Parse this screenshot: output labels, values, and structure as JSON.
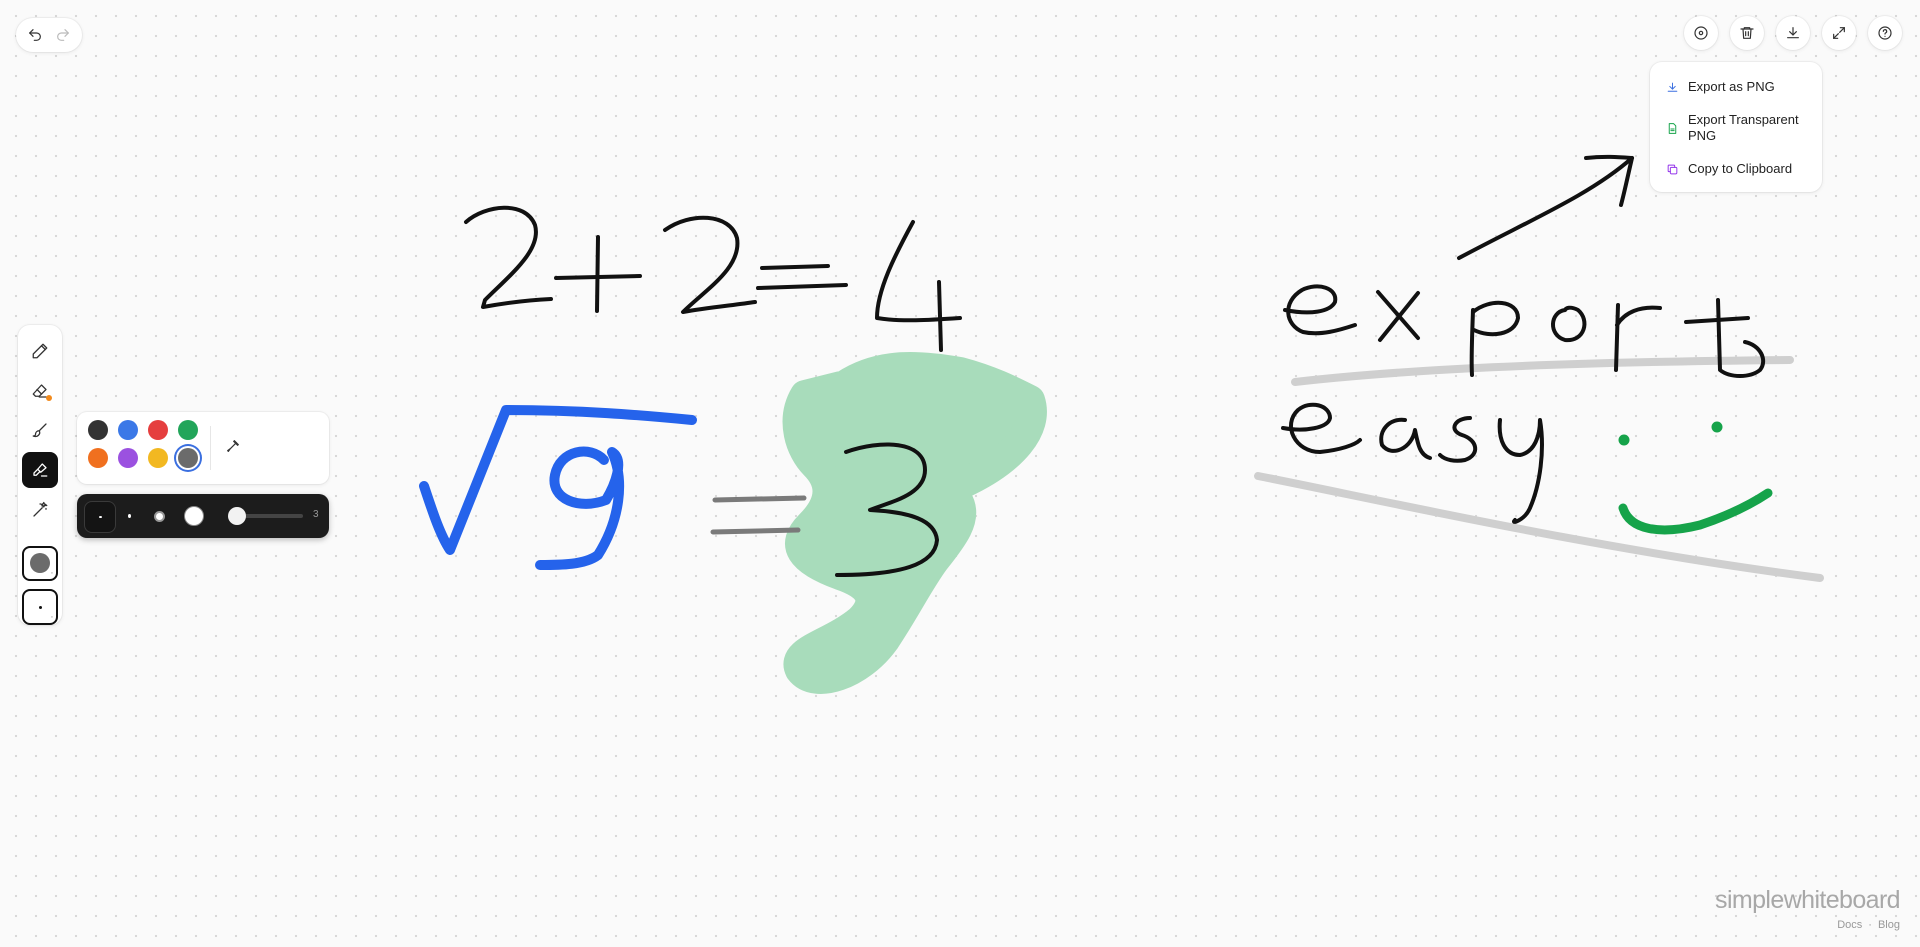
{
  "app": {
    "brand": "simplewhiteboard"
  },
  "footer": {
    "docs": "Docs",
    "separator": "·",
    "blog": "Blog"
  },
  "history": {
    "undo_icon": "undo-icon",
    "redo_icon": "redo-icon"
  },
  "top_toolbar": {
    "items": [
      {
        "name": "info-icon"
      },
      {
        "name": "trash-icon"
      },
      {
        "name": "download-icon"
      },
      {
        "name": "fullscreen-icon"
      },
      {
        "name": "help-icon"
      }
    ]
  },
  "export_menu": {
    "items": [
      {
        "label": "Export as PNG",
        "icon": "download-icon",
        "color": "#3a6fe0"
      },
      {
        "label": "Export Transparent PNG",
        "icon": "file-icon",
        "color": "#16a34a"
      },
      {
        "label": "Copy to Clipboard",
        "icon": "copy-icon",
        "color": "#9333ea"
      }
    ]
  },
  "left_toolbar": {
    "tools": [
      {
        "name": "pencil-tool",
        "icon": "pencil-icon"
      },
      {
        "name": "eraser-tool",
        "icon": "eraser-icon"
      },
      {
        "name": "brush-tool",
        "icon": "brush-icon"
      },
      {
        "name": "highlighter-tool",
        "icon": "highlighter-icon",
        "active": true
      },
      {
        "name": "magic-wand-tool",
        "icon": "wand-icon"
      }
    ],
    "current_color": "#6b6b6b"
  },
  "color_palette": {
    "colors": [
      "#333333",
      "#3b78e7",
      "#e53e3e",
      "#22a55a",
      "#f0701f",
      "#9b51e0",
      "#f2b821",
      "#6b6b6b"
    ],
    "selected": "#6b6b6b"
  },
  "size_bar": {
    "value": "3"
  },
  "colors": {
    "ink_black": "#111111",
    "ink_blue": "#2563eb",
    "ink_green": "#16a34a",
    "highlight_green": "#a8dcbb",
    "highlight_gray": "#cfcfcf",
    "stroke_gray": "#7a7a7a"
  }
}
